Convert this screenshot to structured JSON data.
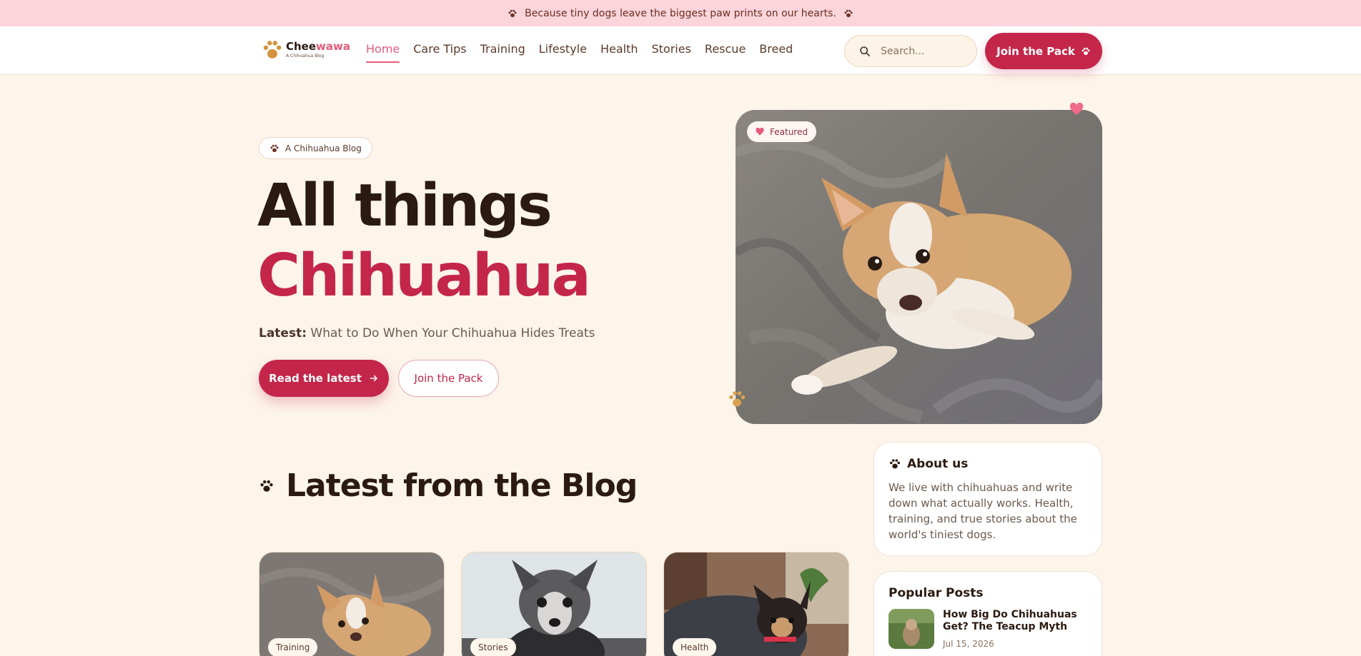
{
  "announcement": {
    "text": "Because tiny dogs leave the biggest paw prints on our hearts."
  },
  "logo": {
    "name_part1": "Chee",
    "name_part2": "wawa",
    "tagline": "A Chihuahua Blog"
  },
  "nav": {
    "items": [
      {
        "label": "Home",
        "active": true
      },
      {
        "label": "Care Tips"
      },
      {
        "label": "Training"
      },
      {
        "label": "Lifestyle"
      },
      {
        "label": "Health"
      },
      {
        "label": "Stories"
      },
      {
        "label": "Rescue"
      },
      {
        "label": "Breed"
      }
    ]
  },
  "search": {
    "placeholder": "Search..."
  },
  "header_cta": {
    "label": "Join the Pack"
  },
  "hero": {
    "badge": "A Chihuahua Blog",
    "title_line1": "All things",
    "title_line2": "Chihuahua",
    "latest_label": "Latest:",
    "latest_title": "What to Do When Your Chihuahua Hides Treats",
    "primary_button": "Read the latest",
    "secondary_button": "Join the Pack",
    "featured_badge": "Featured"
  },
  "blog": {
    "section_title": "Latest from the Blog",
    "cards": [
      {
        "tag": "Training"
      },
      {
        "tag": "Stories"
      },
      {
        "tag": "Health"
      }
    ]
  },
  "sidebar": {
    "about": {
      "title": "About us",
      "text": "We live with chihuahuas and write down what actually works. Health, training, and true stories about the world's tiniest dogs."
    },
    "popular": {
      "title": "Popular Posts",
      "items": [
        {
          "title": "How Big Do Chihuahuas Get? The Teacup Myth",
          "date": "Jul 15, 2026"
        }
      ]
    }
  },
  "colors": {
    "brand": "#c4264a",
    "accent_pink": "#e45b7a",
    "background": "#fdf4ea",
    "announcement_bg": "#fcd5dc"
  }
}
